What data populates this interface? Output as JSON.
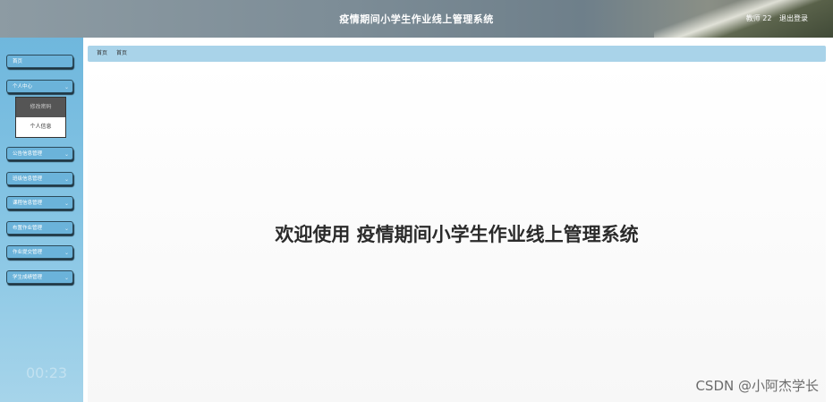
{
  "header": {
    "title": "疫情期间小学生作业线上管理系统",
    "user": "教师 22",
    "logout": "退出登录"
  },
  "sidebar": {
    "home": "首页",
    "personal_center": "个人中心",
    "submenu": [
      "修改密码",
      "个人信息"
    ],
    "items": [
      "公告信息管理",
      "班级信息管理",
      "课程信息管理",
      "布置作业管理",
      "作业提交管理",
      "学生成绩管理"
    ],
    "timer": "00:23"
  },
  "breadcrumb": [
    "首页",
    "首页"
  ],
  "main": {
    "welcome": "欢迎使用 疫情期间小学生作业线上管理系统"
  },
  "watermark": "CSDN @小阿杰学长"
}
